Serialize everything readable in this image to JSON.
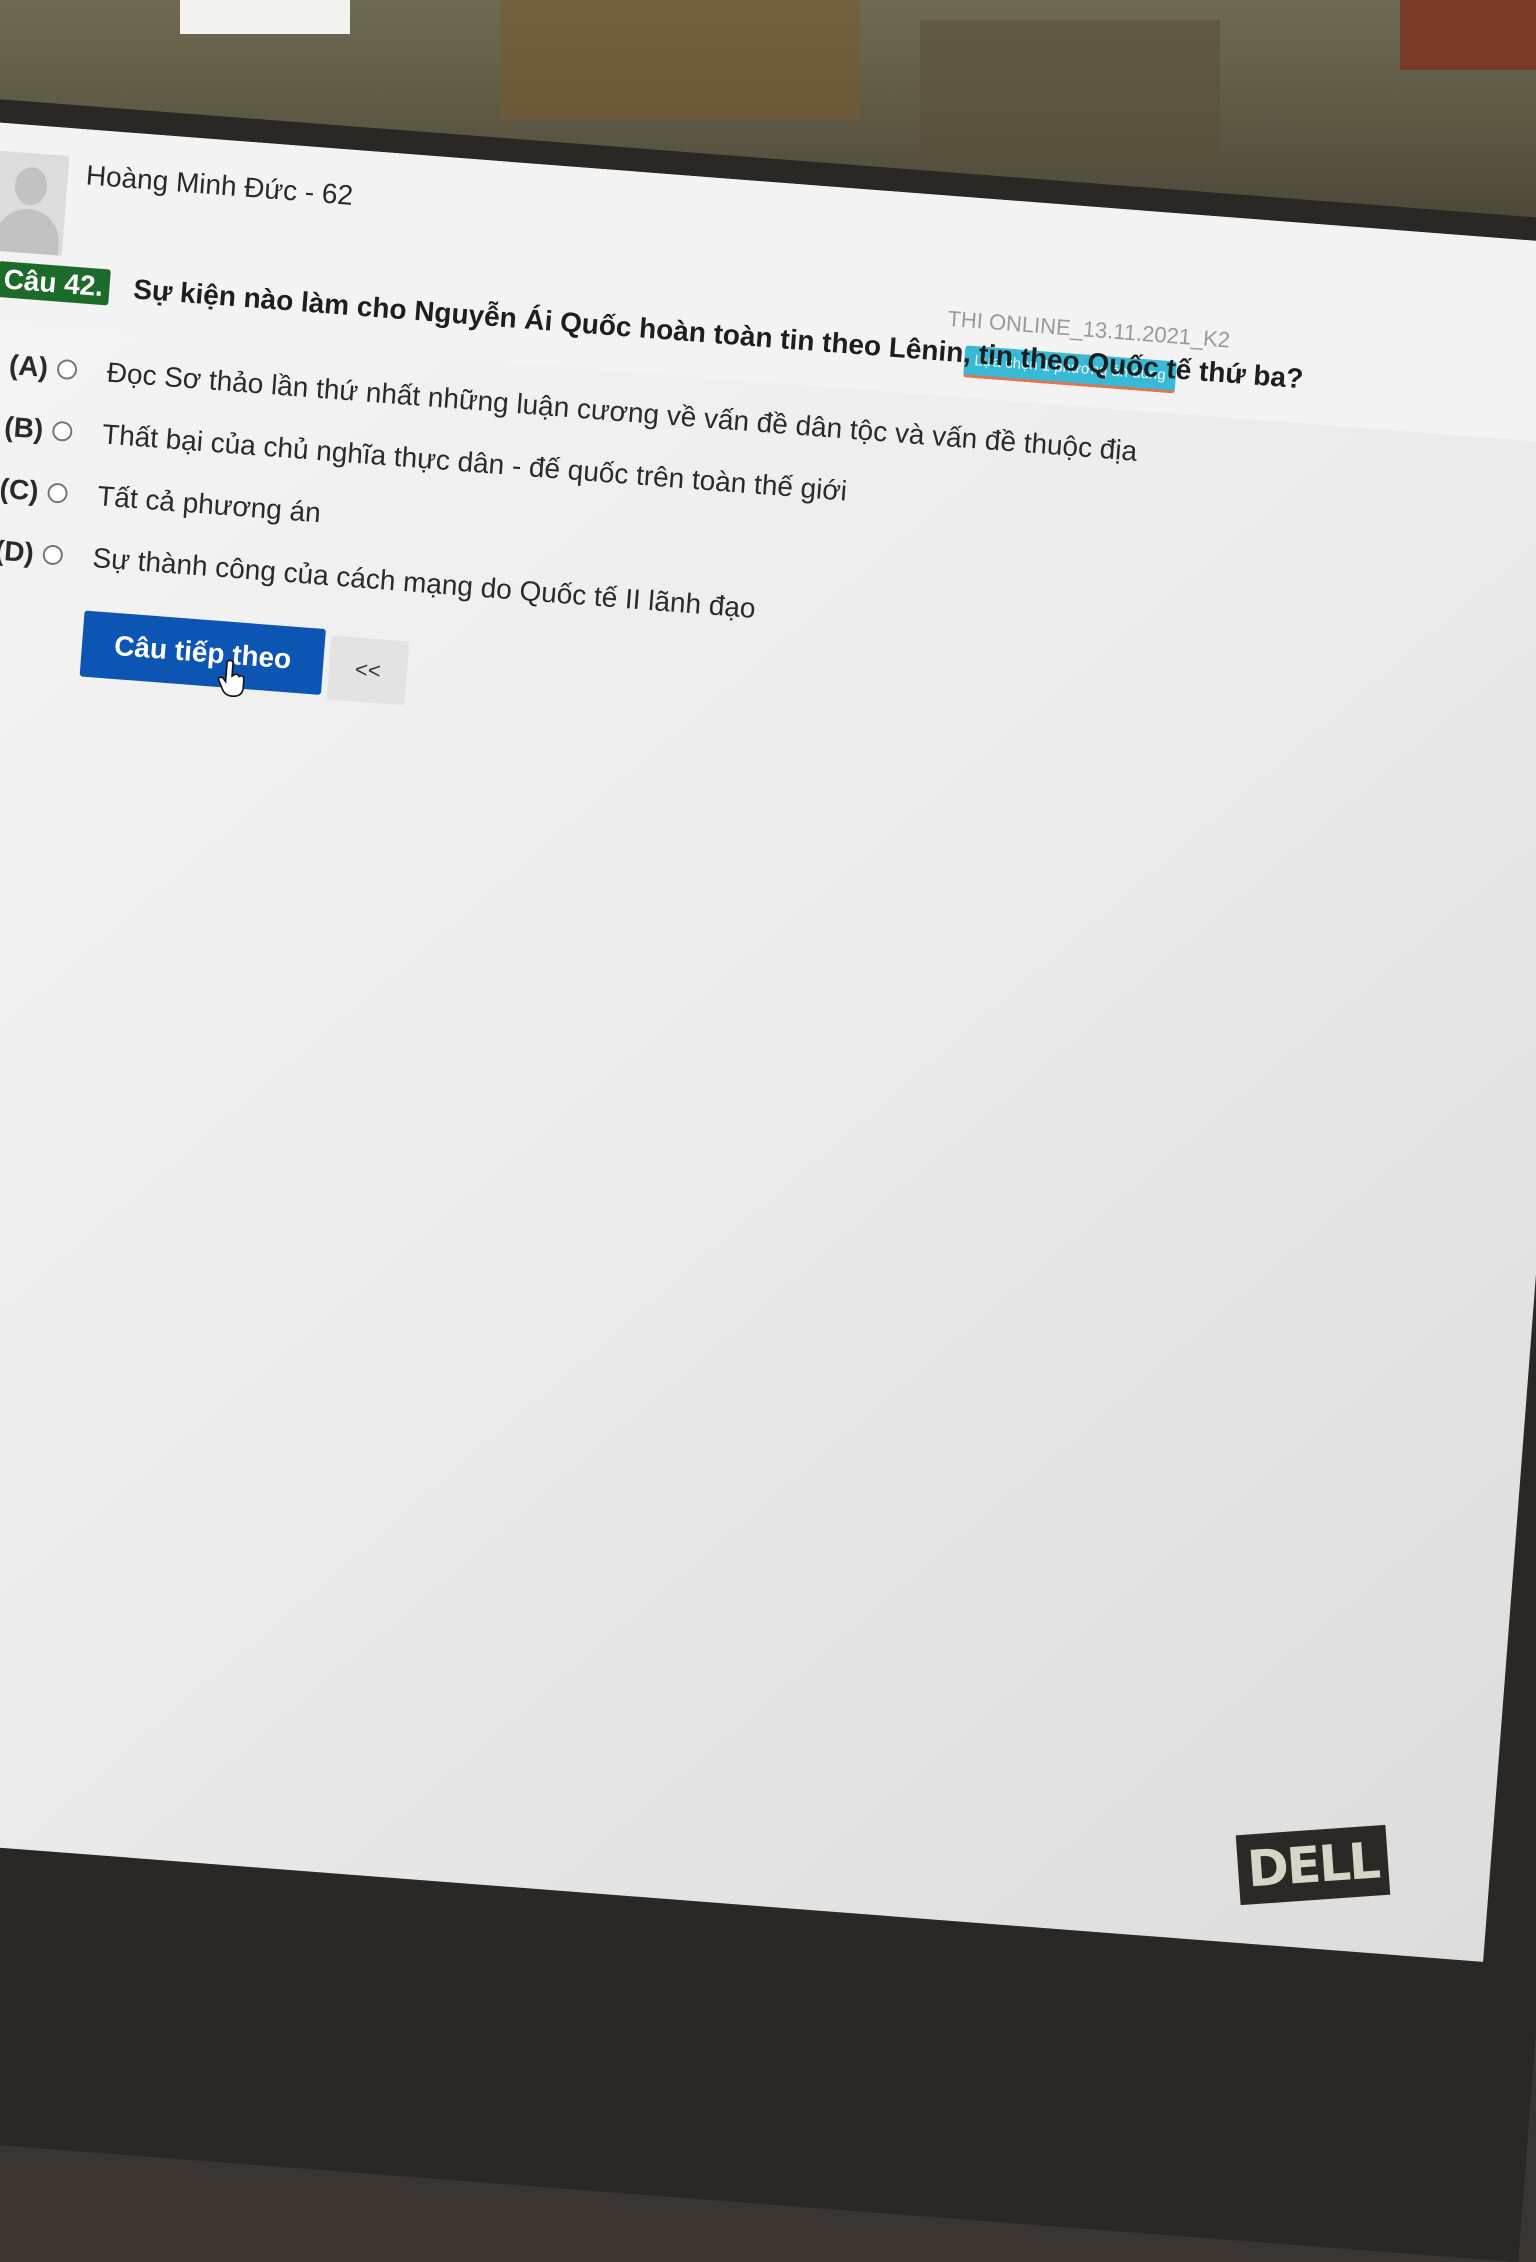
{
  "header": {
    "student_name": "Hoàng Minh Đức - 62",
    "exam_name": "THI ONLINE_13.11.2021_K2",
    "hint": "Lựa chọn 1 phương án đúng"
  },
  "question": {
    "number_label": "Câu 42.",
    "text": "Sự kiện nào làm cho Nguyễn Ái Quốc hoàn toàn tin theo Lênin, tin theo Quốc tế thứ ba?",
    "options": [
      {
        "letter": "(A)",
        "text": "Đọc Sơ thảo lần thứ nhất những luận cương về vấn đề dân tộc và vấn đề thuộc địa"
      },
      {
        "letter": "(B)",
        "text": "Thất bại của chủ nghĩa thực dân - đế quốc trên toàn thế giới"
      },
      {
        "letter": "(C)",
        "text": "Tất cả phương án"
      },
      {
        "letter": "(D)",
        "text": "Sự thành công của cách mạng do Quốc tế II lãnh đạo"
      }
    ]
  },
  "nav": {
    "next_label": "Câu tiếp theo",
    "prev_label": "<<"
  },
  "device": {
    "logo": "DELL"
  },
  "colors": {
    "question_badge": "#1d6b2a",
    "next_button": "#0c55b3",
    "hint_badge": "#38b9d6"
  },
  "icons": [
    "avatar-placeholder-icon",
    "radio-icon",
    "hand-cursor-icon",
    "webcam-icon"
  ]
}
